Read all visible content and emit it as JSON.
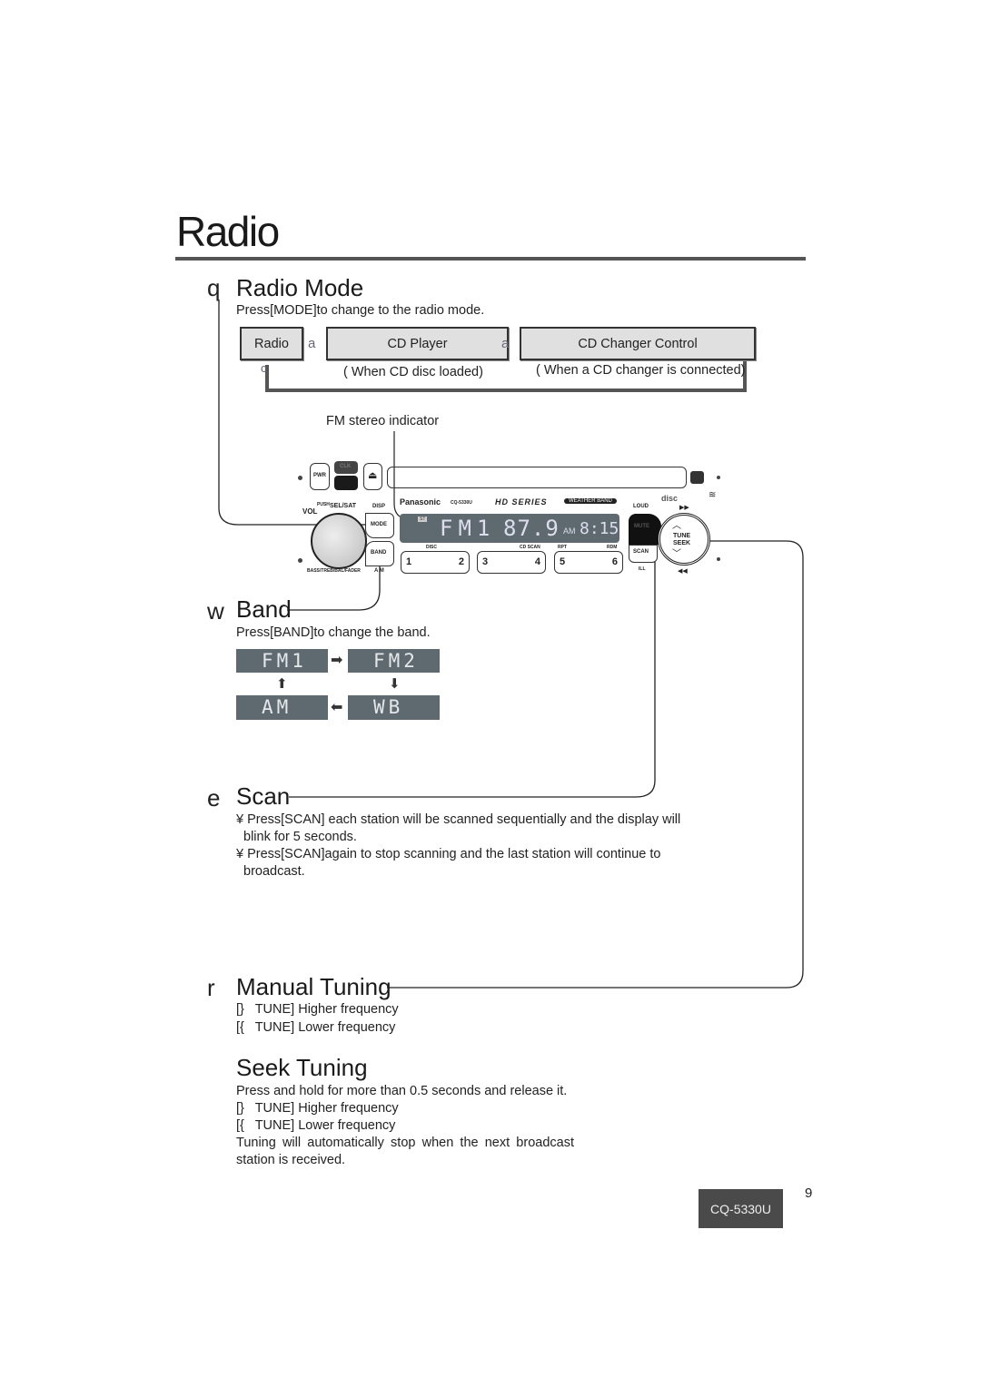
{
  "page": {
    "title": "Radio",
    "page_number": "9",
    "model": "CQ-5330U"
  },
  "radio_mode": {
    "letter": "q",
    "heading": "Radio Mode",
    "instruction": "Press[MODE]to change to the radio mode.",
    "modes": [
      {
        "label": "Radio",
        "note": ""
      },
      {
        "label": "CD Player",
        "note": "( When CD disc loaded)"
      },
      {
        "label": "CD Changer Control",
        "note": "( When a CD changer is connected)"
      }
    ],
    "arrow_glyph": "a",
    "return_glyph": "c"
  },
  "unit": {
    "callout": "FM stereo indicator",
    "brand": "Panasonic",
    "model_small": "CQ-5330U",
    "series": "HD SERIES",
    "weather": "WEATHER BAND",
    "buttons": {
      "pwr": "PWR",
      "clk": "CLK",
      "vol": "VOL",
      "push": "PUSH",
      "sel": "SEL/SAT",
      "disp": "DISP",
      "mode": "MODE",
      "band": "BAND",
      "am": "A M",
      "bass": "BASS/TREB/BAL/FADER",
      "loud": "LOUD",
      "mute": "MUTE",
      "scan": "SCAN",
      "ill": "ILL",
      "tune": "TUNE",
      "seek": "SEEK",
      "disc": "DISC",
      "cdscan": "CD SCAN",
      "rpt": "RPT",
      "rdm": "RDM",
      "st": "ST"
    },
    "presets": [
      "1",
      "2",
      "3",
      "4",
      "5",
      "6"
    ],
    "display": {
      "band": "FM1",
      "freq": "87.9",
      "ampm": "AM",
      "clock": "8:15"
    }
  },
  "band": {
    "letter": "w",
    "heading": "Band",
    "instruction": "Press[BAND]to change the band.",
    "cycle": [
      "FM1",
      "FM2",
      "WB",
      "AM"
    ]
  },
  "scan": {
    "letter": "e",
    "heading": "Scan",
    "bullets": [
      "¥ Press[SCAN] each station will be scanned sequentially and the display will blink for 5 seconds.",
      "¥ Press[SCAN]again to stop scanning and the last station will continue to broadcast."
    ]
  },
  "manual_tuning": {
    "letter": "r",
    "heading": "Manual Tuning",
    "lines": [
      "[}   TUNE] Higher frequency",
      "[{   TUNE] Lower frequency"
    ]
  },
  "seek_tuning": {
    "heading": "Seek Tuning",
    "intro": "Press and hold for more than 0.5 seconds and release it.",
    "lines": [
      "[}   TUNE] Higher frequency",
      "[{   TUNE] Lower frequency"
    ],
    "note": "Tuning will automatically stop when the next broadcast station is received."
  }
}
